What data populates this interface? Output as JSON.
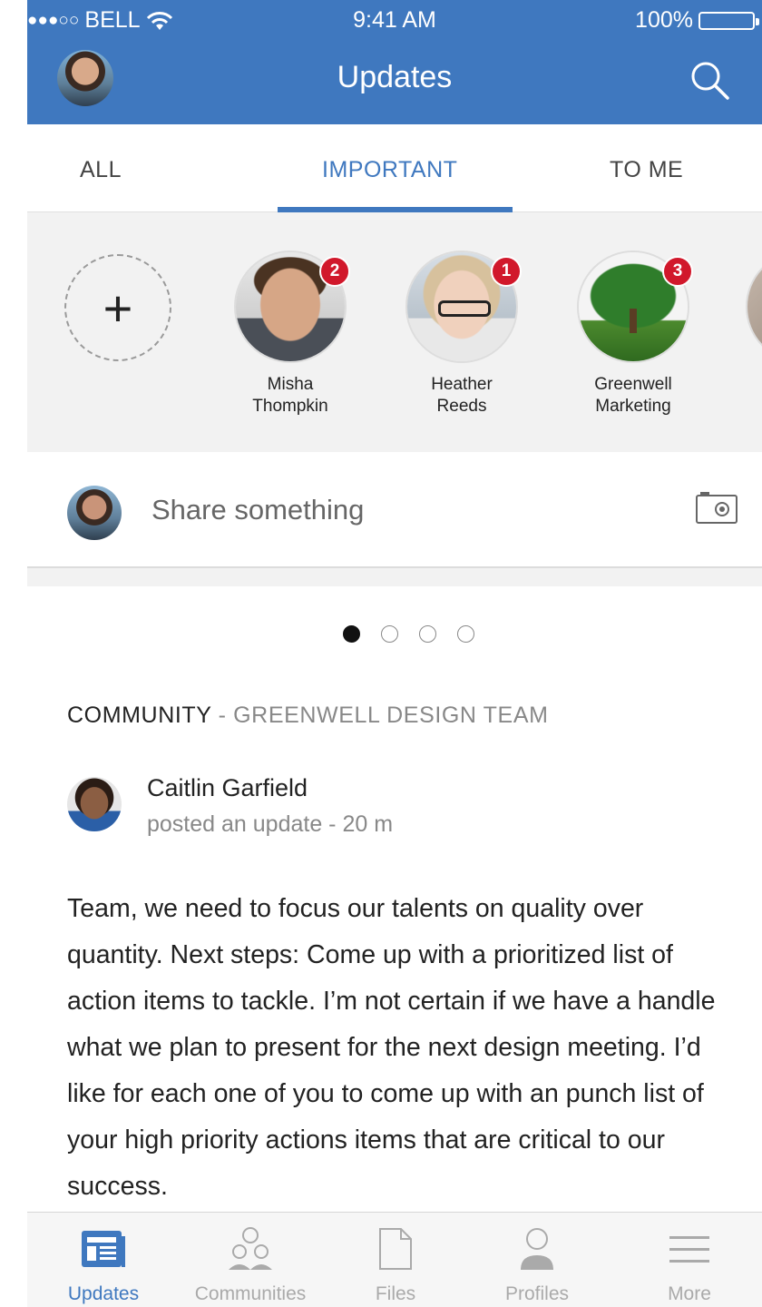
{
  "status_bar": {
    "signal": "●●●○○",
    "carrier": "BELL",
    "time": "9:41 AM",
    "battery": "100%"
  },
  "header": {
    "title": "Updates"
  },
  "tabs": [
    {
      "label": "ALL",
      "active": false
    },
    {
      "label": "IMPORTANT",
      "active": true
    },
    {
      "label": "TO ME",
      "active": false
    }
  ],
  "stories": {
    "add_label": "+",
    "items": [
      {
        "name_line1": "Misha",
        "name_line2": "Thompkin",
        "badge": "2"
      },
      {
        "name_line1": "Heather",
        "name_line2": "Reeds",
        "badge": "1"
      },
      {
        "name_line1": "Greenwell",
        "name_line2": "Marketing",
        "badge": "3"
      }
    ]
  },
  "share": {
    "placeholder": "Share something"
  },
  "pager": {
    "total": 4,
    "active_index": 0
  },
  "post": {
    "kind": "COMMUNITY",
    "separator": " - ",
    "group": "GREENWELL DESIGN TEAM",
    "author": "Caitlin Garfield",
    "meta": "posted an update - 20 m",
    "body": "Team, we need to focus our talents  on quality over quantity. Next steps: Come up with a prioritized list of action items to tackle. I’m not certain if we have a handle what we plan to present for the next design meeting. I’d like for each one of you to come up with an punch list of your high priority actions items that are critical to our success."
  },
  "bottom_nav": [
    {
      "label": "Updates",
      "icon": "updates-icon",
      "active": true
    },
    {
      "label": "Communities",
      "icon": "communities-icon",
      "active": false
    },
    {
      "label": "Files",
      "icon": "file-icon",
      "active": false
    },
    {
      "label": "Profiles",
      "icon": "profile-icon",
      "active": false
    },
    {
      "label": "More",
      "icon": "menu-icon",
      "active": false
    }
  ],
  "colors": {
    "brand_blue": "#3f78bf",
    "badge_red": "#d1182b",
    "inactive_grey": "#aaaaaa"
  }
}
